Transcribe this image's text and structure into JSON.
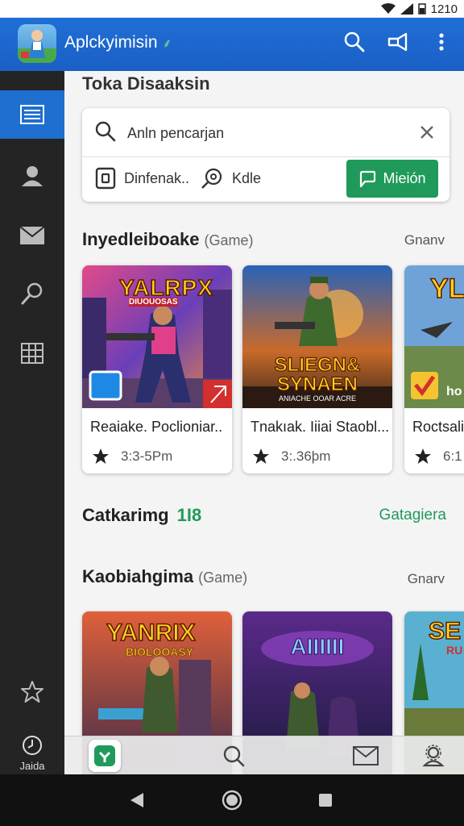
{
  "status": {
    "time": "1210"
  },
  "app": {
    "title": "Aplckyimisin",
    "sprout": "⸙"
  },
  "page": {
    "heading": "Toka Disaaksin"
  },
  "search": {
    "placeholder": "Anln pencarjan",
    "filter1": "Dinfenak..",
    "filter2": "Kdle",
    "button": "Mieión"
  },
  "section1": {
    "title": "Inyedleiboake",
    "subtitle": "(Game)",
    "more": "Gnanv",
    "cards": [
      {
        "title": "Reaiake. Poclioniar..",
        "rating": "3:3-5Pm",
        "art_text": "YALRPX",
        "art_sub": "DIUOUOSAS"
      },
      {
        "title": "Tnakıak. Iiiai Staobl...",
        "rating": "3:.36þm",
        "art_text": "SLIEGN& SYNAEN",
        "art_sub": "ANIACHE OOAR ACRE"
      },
      {
        "title": "Roctsali",
        "rating": "6:1",
        "art_text": "YL",
        "art_sub": "ho"
      }
    ]
  },
  "category": {
    "label": "Catkarimg",
    "count": "1I8",
    "link": "Gatagiera"
  },
  "section2": {
    "title": "Kaobiahgima",
    "subtitle": "(Game)",
    "more": "Gnarv",
    "cards": [
      {
        "art_text": "YANRIX",
        "art_sub": "BIOLOOASY"
      },
      {
        "art_text": "AIIIIII",
        "art_sub": ""
      },
      {
        "art_text": "SE",
        "art_sub": "RU"
      }
    ]
  },
  "sidebar": {
    "bottom_label": "Jaida"
  },
  "icons": {
    "menu": "list-icon",
    "user": "person-icon",
    "mail": "mail-icon",
    "search": "search-icon",
    "grid": "grid-icon",
    "star": "star-icon",
    "clock": "clock-icon"
  },
  "colors": {
    "primary": "#1e6fd0",
    "accent_green": "#1f9a5a",
    "sidebar": "#242424"
  }
}
